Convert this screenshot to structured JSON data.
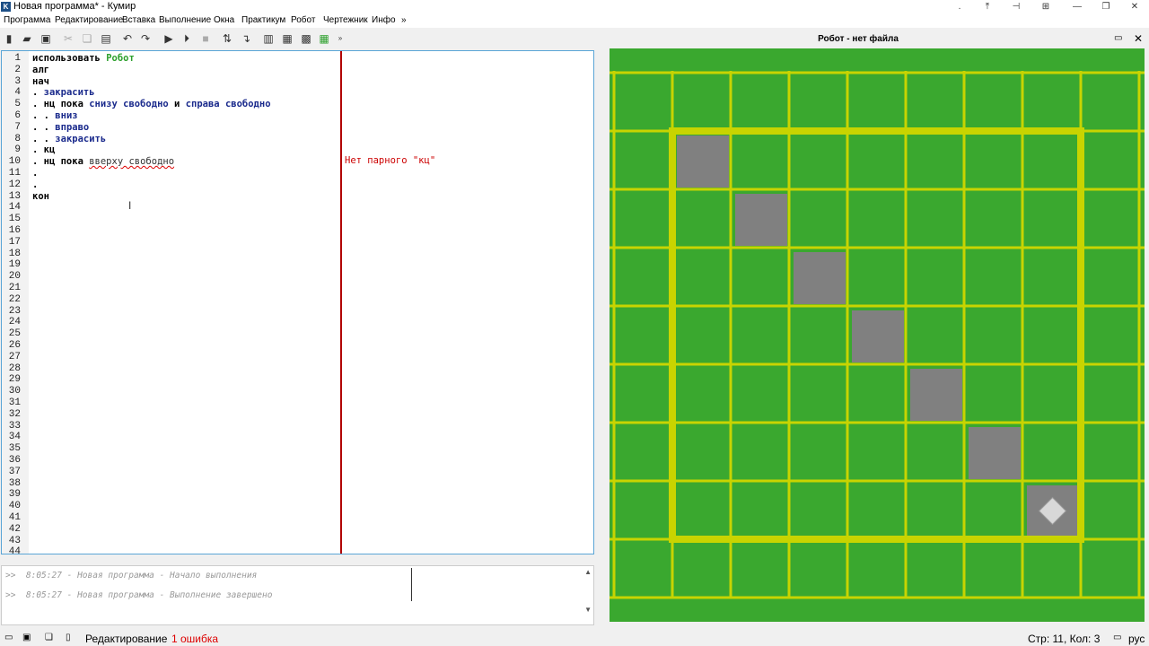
{
  "window": {
    "title": "Новая программа* - Кумир",
    "icon_letter": "K"
  },
  "menu": [
    "Программа",
    "Редактирование",
    "Вставка",
    "Выполнение",
    "Окна",
    "Практикум",
    "Робот",
    "Чертежник",
    "Инфо",
    "»"
  ],
  "toolbar_icons": [
    "new-file-icon",
    "open-folder-icon",
    "save-icon",
    "cut-icon",
    "copy-icon",
    "paste-icon",
    "undo-icon",
    "redo-icon",
    "run-icon",
    "step-run-icon",
    "stop-icon",
    "step-over-icon",
    "step-into-icon",
    "variables-icon",
    "table-icon",
    "robot-window-icon",
    "grid-icon",
    "more-icon"
  ],
  "editor": {
    "line_numbers": [
      "1",
      "2",
      "3",
      "4",
      "5",
      "6",
      "7",
      "8",
      "9",
      "10",
      "11",
      "12",
      "13",
      "14",
      "15",
      "16",
      "17",
      "18",
      "19",
      "20",
      "21",
      "22",
      "23",
      "24",
      "25",
      "26",
      "27",
      "28",
      "29",
      "30",
      "31",
      "32",
      "33",
      "34",
      "35",
      "36",
      "37",
      "38",
      "39",
      "40",
      "41",
      "42",
      "43",
      "44"
    ],
    "lines": [
      {
        "a": "использовать ",
        "b": "Робот",
        "c": ""
      },
      {
        "a": "алг",
        "b": "",
        "c": ""
      },
      {
        "a": "нач",
        "b": "",
        "c": ""
      },
      {
        "a": ". ",
        "b": "",
        "c": "закрасить"
      },
      {
        "a": ". нц пока ",
        "b": "",
        "c": "снизу свободно",
        "d": " и ",
        "e": "справа свободно"
      },
      {
        "a": ". . ",
        "b": "",
        "c": "вниз"
      },
      {
        "a": ". . ",
        "b": "",
        "c": "вправо"
      },
      {
        "a": ". . ",
        "b": "",
        "c": "закрасить"
      },
      {
        "a": ". кц",
        "b": "",
        "c": ""
      },
      {
        "a": ". нц пока ",
        "b": "",
        "c": "",
        "u": "вверху свободно"
      },
      {
        "a": ".",
        "b": "",
        "c": ""
      },
      {
        "a": ".",
        "b": "",
        "c": ""
      },
      {
        "a": "кон",
        "b": "",
        "c": ""
      }
    ],
    "error_message": "Нет парного \"кц\""
  },
  "console": {
    "lines": [
      ">>  8:05:27 - Новая программа - Начало выполнения",
      ">>  8:05:27 - Новая программа - Выполнение завершено"
    ]
  },
  "status": {
    "mode": "Редактирование",
    "errors": "1 ошибка",
    "position": "Стр: 11, Кол: 3",
    "language": "рус"
  },
  "robot": {
    "title": "Робот - нет файла",
    "colors": {
      "field": "#3aa82f",
      "grid": "#c8d400",
      "painted": "#808080",
      "robot": "#d8d8d8"
    },
    "painted_cells": [
      [
        0,
        0
      ],
      [
        1,
        1
      ],
      [
        2,
        2
      ],
      [
        3,
        3
      ],
      [
        4,
        4
      ],
      [
        5,
        5
      ],
      [
        6,
        6
      ]
    ],
    "robot_cell": [
      6,
      6
    ]
  }
}
